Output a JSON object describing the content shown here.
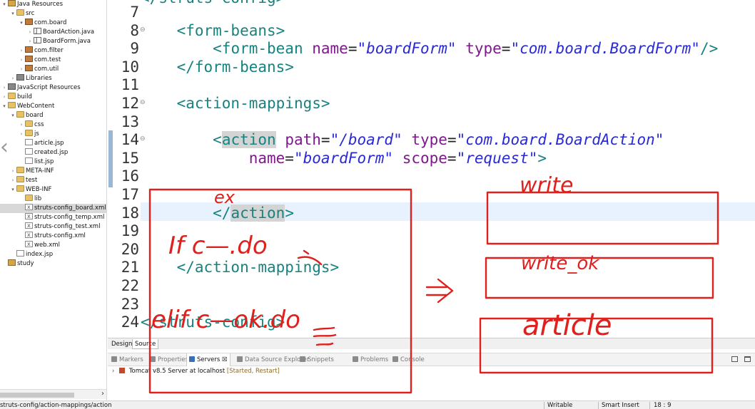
{
  "explorer": {
    "items": [
      {
        "label": "Java Resources",
        "icon": "project-icon",
        "twisty": "▾",
        "indent": 0
      },
      {
        "label": "src",
        "icon": "folder-icon",
        "twisty": "▾",
        "indent": 1
      },
      {
        "label": "com.board",
        "icon": "package-icon",
        "twisty": "▾",
        "indent": 2
      },
      {
        "label": "BoardAction.java",
        "icon": "java-file-icon",
        "twisty": "›",
        "indent": 3
      },
      {
        "label": "BoardForm.java",
        "icon": "java-file-icon",
        "twisty": "›",
        "indent": 3
      },
      {
        "label": "com.filter",
        "icon": "package-icon",
        "twisty": "›",
        "indent": 2
      },
      {
        "label": "com.test",
        "icon": "package-icon",
        "twisty": "›",
        "indent": 2
      },
      {
        "label": "com.util",
        "icon": "package-icon",
        "twisty": "›",
        "indent": 2
      },
      {
        "label": "Libraries",
        "icon": "library-icon",
        "twisty": "›",
        "indent": 1
      },
      {
        "label": "JavaScript Resources",
        "icon": "library-icon",
        "twisty": "›",
        "indent": 0
      },
      {
        "label": "build",
        "icon": "folder-icon",
        "twisty": "›",
        "indent": 0
      },
      {
        "label": "WebContent",
        "icon": "folder-icon",
        "twisty": "▾",
        "indent": 0
      },
      {
        "label": "board",
        "icon": "folder-icon",
        "twisty": "▾",
        "indent": 1
      },
      {
        "label": "css",
        "icon": "folder-icon",
        "twisty": "›",
        "indent": 2
      },
      {
        "label": "js",
        "icon": "folder-icon",
        "twisty": "›",
        "indent": 2
      },
      {
        "label": "article.jsp",
        "icon": "jsp-file-icon",
        "twisty": "",
        "indent": 2
      },
      {
        "label": "created.jsp",
        "icon": "jsp-file-icon",
        "twisty": "",
        "indent": 2
      },
      {
        "label": "list.jsp",
        "icon": "jsp-file-icon",
        "twisty": "",
        "indent": 2
      },
      {
        "label": "META-INF",
        "icon": "folder-icon",
        "twisty": "›",
        "indent": 1
      },
      {
        "label": "test",
        "icon": "folder-icon",
        "twisty": "›",
        "indent": 1
      },
      {
        "label": "WEB-INF",
        "icon": "folder-icon",
        "twisty": "▾",
        "indent": 1
      },
      {
        "label": "lib",
        "icon": "folder-icon",
        "twisty": "",
        "indent": 2
      },
      {
        "label": "struts-config_board.xml",
        "icon": "xml-file-icon",
        "twisty": "",
        "indent": 2,
        "selected": true
      },
      {
        "label": "struts-config_temp.xml",
        "icon": "xml-file-icon",
        "twisty": "",
        "indent": 2
      },
      {
        "label": "struts-config_test.xml",
        "icon": "xml-file-icon",
        "twisty": "",
        "indent": 2
      },
      {
        "label": "struts-config.xml",
        "icon": "xml-file-icon",
        "twisty": "",
        "indent": 2
      },
      {
        "label": "web.xml",
        "icon": "xml-file-icon",
        "twisty": "",
        "indent": 2
      },
      {
        "label": "index.jsp",
        "icon": "jsp-file-icon",
        "twisty": "",
        "indent": 1
      },
      {
        "label": "study",
        "icon": "project-icon",
        "twisty": "",
        "indent": 0
      }
    ]
  },
  "editor": {
    "top_fragment": "</struts-config>",
    "lines": [
      {
        "n": "7",
        "fold": false,
        "tokens": []
      },
      {
        "n": "8",
        "fold": true,
        "tokens": [
          {
            "t": "    ",
            "c": ""
          },
          {
            "t": "<form-beans>",
            "c": "tag"
          }
        ]
      },
      {
        "n": "9",
        "fold": false,
        "tokens": [
          {
            "t": "        ",
            "c": ""
          },
          {
            "t": "<form-bean ",
            "c": "tag"
          },
          {
            "t": "name",
            "c": "attr"
          },
          {
            "t": "=",
            "c": "eq"
          },
          {
            "t": "\"boardForm\"",
            "c": "val"
          },
          {
            "t": " ",
            "c": ""
          },
          {
            "t": "type",
            "c": "attr"
          },
          {
            "t": "=",
            "c": "eq"
          },
          {
            "t": "\"com.board.BoardForm\"",
            "c": "val"
          },
          {
            "t": "/>",
            "c": "tag"
          }
        ]
      },
      {
        "n": "10",
        "fold": false,
        "tokens": [
          {
            "t": "    ",
            "c": ""
          },
          {
            "t": "</form-beans>",
            "c": "tag"
          }
        ]
      },
      {
        "n": "11",
        "fold": false,
        "tokens": []
      },
      {
        "n": "12",
        "fold": true,
        "tokens": [
          {
            "t": "    ",
            "c": ""
          },
          {
            "t": "<action-mappings>",
            "c": "tag"
          }
        ]
      },
      {
        "n": "13",
        "fold": false,
        "tokens": []
      },
      {
        "n": "14",
        "fold": true,
        "tokens": [
          {
            "t": "        ",
            "c": ""
          },
          {
            "t": "<",
            "c": "tag"
          },
          {
            "t": "action",
            "c": "tag hl"
          },
          {
            "t": " ",
            "c": ""
          },
          {
            "t": "path",
            "c": "attr"
          },
          {
            "t": "=",
            "c": "eq"
          },
          {
            "t": "\"/board\"",
            "c": "val"
          },
          {
            "t": " ",
            "c": ""
          },
          {
            "t": "type",
            "c": "attr"
          },
          {
            "t": "=",
            "c": "eq"
          },
          {
            "t": "\"com.board.BoardAction\"",
            "c": "val"
          }
        ]
      },
      {
        "n": "15",
        "fold": false,
        "tokens": [
          {
            "t": "            ",
            "c": ""
          },
          {
            "t": "name",
            "c": "attr"
          },
          {
            "t": "=",
            "c": "eq"
          },
          {
            "t": "\"boardForm\"",
            "c": "val"
          },
          {
            "t": " ",
            "c": ""
          },
          {
            "t": "scope",
            "c": "attr"
          },
          {
            "t": "=",
            "c": "eq"
          },
          {
            "t": "\"request\"",
            "c": "val"
          },
          {
            "t": ">",
            "c": "tag"
          }
        ]
      },
      {
        "n": "16",
        "fold": false,
        "tokens": []
      },
      {
        "n": "17",
        "fold": false,
        "tokens": []
      },
      {
        "n": "18",
        "fold": false,
        "tokens": [
          {
            "t": "        ",
            "c": ""
          },
          {
            "t": "</",
            "c": "tag"
          },
          {
            "t": "action",
            "c": "tag hl"
          },
          {
            "t": ">",
            "c": "tag"
          }
        ]
      },
      {
        "n": "19",
        "fold": false,
        "tokens": []
      },
      {
        "n": "20",
        "fold": false,
        "tokens": []
      },
      {
        "n": "21",
        "fold": false,
        "tokens": [
          {
            "t": "    ",
            "c": ""
          },
          {
            "t": "</action-mappings>",
            "c": "tag"
          }
        ]
      },
      {
        "n": "22",
        "fold": false,
        "tokens": []
      },
      {
        "n": "23",
        "fold": false,
        "tokens": []
      },
      {
        "n": "24",
        "fold": false,
        "tokens": [
          {
            "t": "</struts-config>",
            "c": "tag"
          }
        ]
      }
    ]
  },
  "editor_tabs": {
    "design": "Design",
    "source": "Source"
  },
  "views": {
    "tabs": [
      {
        "label": "Markers",
        "icon_color": "#8a8a8a"
      },
      {
        "label": "Properties",
        "icon_color": "#8a8a8a"
      },
      {
        "label": "Servers",
        "icon_color": "#3a6fb5",
        "active": true
      },
      {
        "label": "Data Source Explorer",
        "icon_color": "#8a8a8a"
      },
      {
        "label": "Snippets",
        "icon_color": "#8a8a8a"
      },
      {
        "label": "Problems",
        "icon_color": "#8a8a8a"
      },
      {
        "label": "Console",
        "icon_color": "#8a8a8a"
      }
    ],
    "servers_close": "☒",
    "server": {
      "name": "Tomcat v8.5 Server at localhost",
      "status": "[Started, Restart]"
    }
  },
  "status_bar": {
    "path": "struts-config/action-mappings/action",
    "writable": "Writable",
    "insert_mode": "Smart Insert",
    "position": "18 : 9"
  },
  "annotations": {
    "ex": "ex",
    "if_line": "If  c—.do",
    "elif_line": "elif  c—ok.do",
    "write": "write",
    "write_ok": "write_ok",
    "article": "article",
    "stroke_color": "#e0201c"
  }
}
